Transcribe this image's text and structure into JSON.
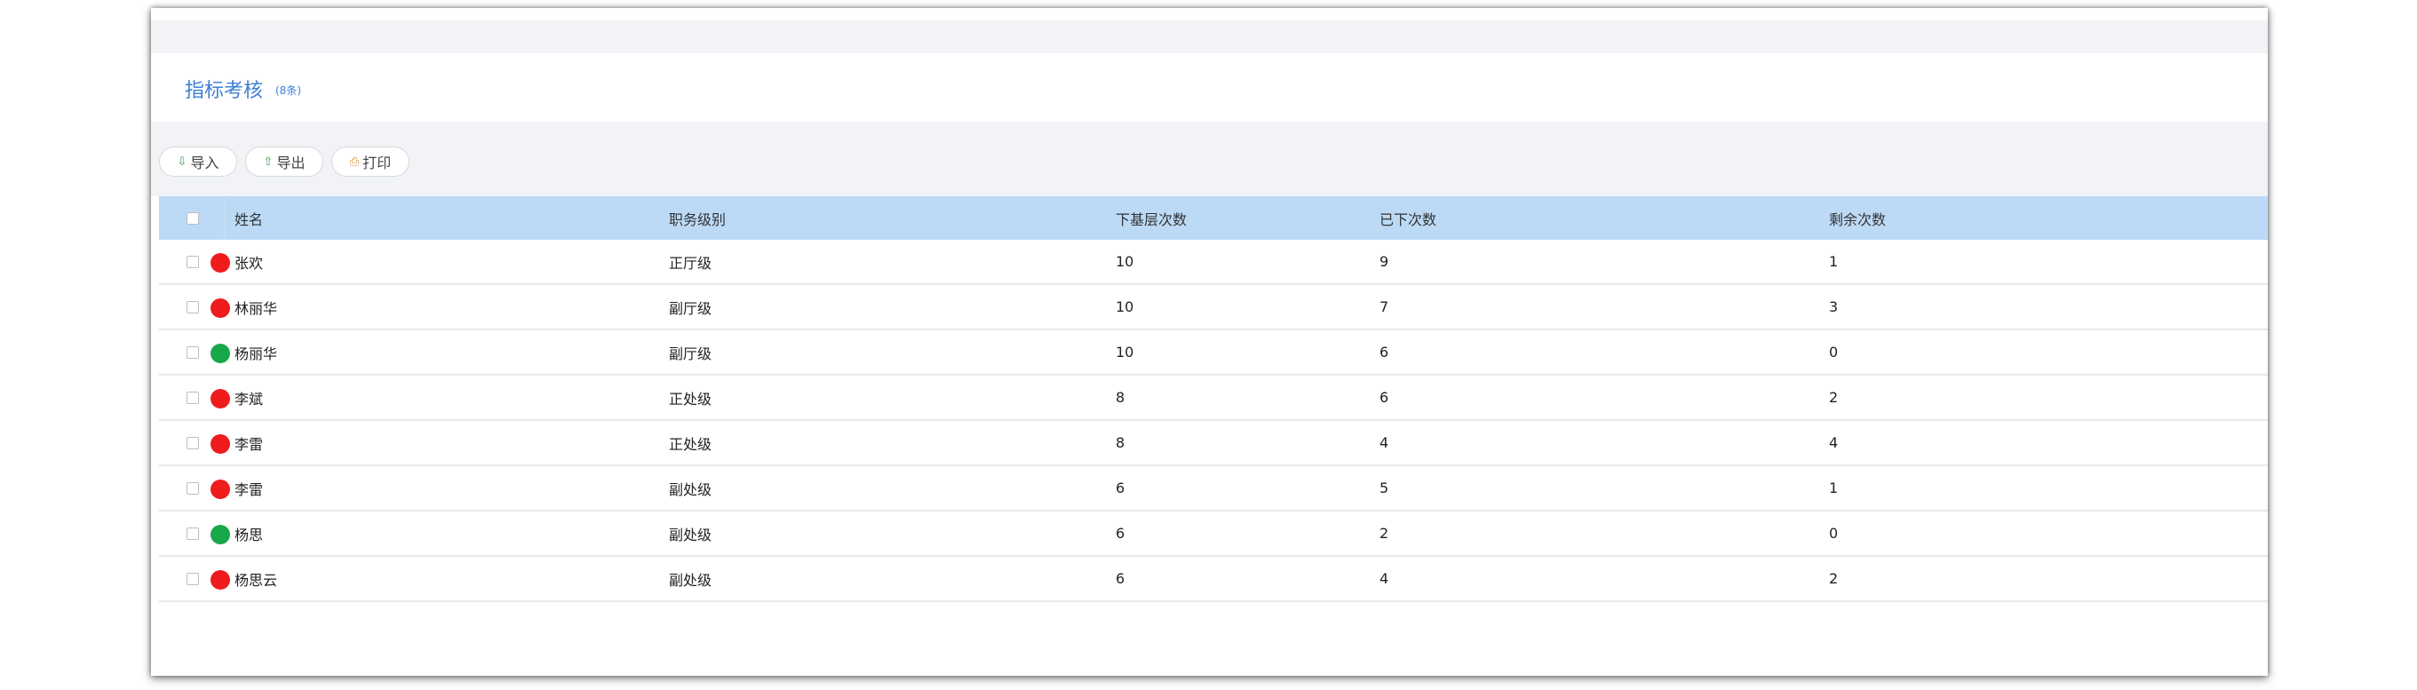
{
  "header": {
    "title": "指标考核",
    "count": "(8条)"
  },
  "toolbar": {
    "import_label": "导入",
    "export_label": "导出",
    "print_label": "打印"
  },
  "colors": {
    "red": "#ee1c1c",
    "green": "#17a84a",
    "header_bg": "#bcdaf6",
    "title": "#3f7fd4"
  },
  "table": {
    "columns": [
      "姓名",
      "职务级别",
      "下基层次数",
      "已下次数",
      "剩余次数"
    ],
    "rows": [
      {
        "status": "red",
        "name": "张欢",
        "level": "正厅级",
        "required": "10",
        "done": "9",
        "remaining": "1"
      },
      {
        "status": "red",
        "name": "林丽华",
        "level": "副厅级",
        "required": "10",
        "done": "7",
        "remaining": "3"
      },
      {
        "status": "green",
        "name": "杨丽华",
        "level": "副厅级",
        "required": "10",
        "done": "6",
        "remaining": "0"
      },
      {
        "status": "red",
        "name": "李斌",
        "level": "正处级",
        "required": "8",
        "done": "6",
        "remaining": "2"
      },
      {
        "status": "red",
        "name": "李雷",
        "level": "正处级",
        "required": "8",
        "done": "4",
        "remaining": "4"
      },
      {
        "status": "red",
        "name": "李雷",
        "level": "副处级",
        "required": "6",
        "done": "5",
        "remaining": "1"
      },
      {
        "status": "green",
        "name": "杨思",
        "level": "副处级",
        "required": "6",
        "done": "2",
        "remaining": "0"
      },
      {
        "status": "red",
        "name": "杨思云",
        "level": "副处级",
        "required": "6",
        "done": "4",
        "remaining": "2"
      }
    ]
  }
}
